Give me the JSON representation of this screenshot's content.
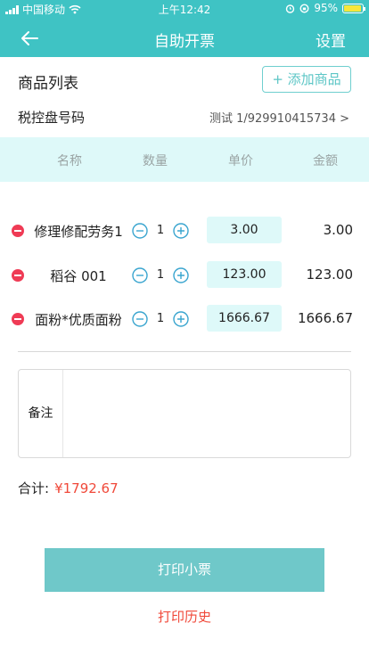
{
  "status_bar": {
    "carrier": "中国移动",
    "time": "上午12:42",
    "battery": "95%"
  },
  "nav": {
    "title": "自助开票",
    "settings_label": "设置"
  },
  "goods": {
    "label": "商品列表",
    "add_label": "+ 添加商品"
  },
  "tax_disk": {
    "label": "税控盘号码",
    "value": "测试 1/929910415734 >"
  },
  "table": {
    "headers": [
      "名称",
      "数量",
      "单价",
      "金额"
    ],
    "rows": [
      {
        "name": "修理修配劳务1",
        "qty": "1",
        "price": "3.00",
        "amount": "3.00"
      },
      {
        "name": "稻谷 001",
        "qty": "1",
        "price": "123.00",
        "amount": "123.00"
      },
      {
        "name": "面粉*优质面粉",
        "qty": "1",
        "price": "1666.67",
        "amount": "1666.67"
      }
    ]
  },
  "remark": {
    "label": "备注",
    "value": ""
  },
  "total": {
    "label": "合计:",
    "value": "¥1792.67"
  },
  "actions": {
    "print_label": "打印小票",
    "history_label": "打印历史"
  },
  "colors": {
    "brand": "#3fc3c4",
    "accent_red": "#f0493a",
    "light_cyan": "#def9f9"
  }
}
